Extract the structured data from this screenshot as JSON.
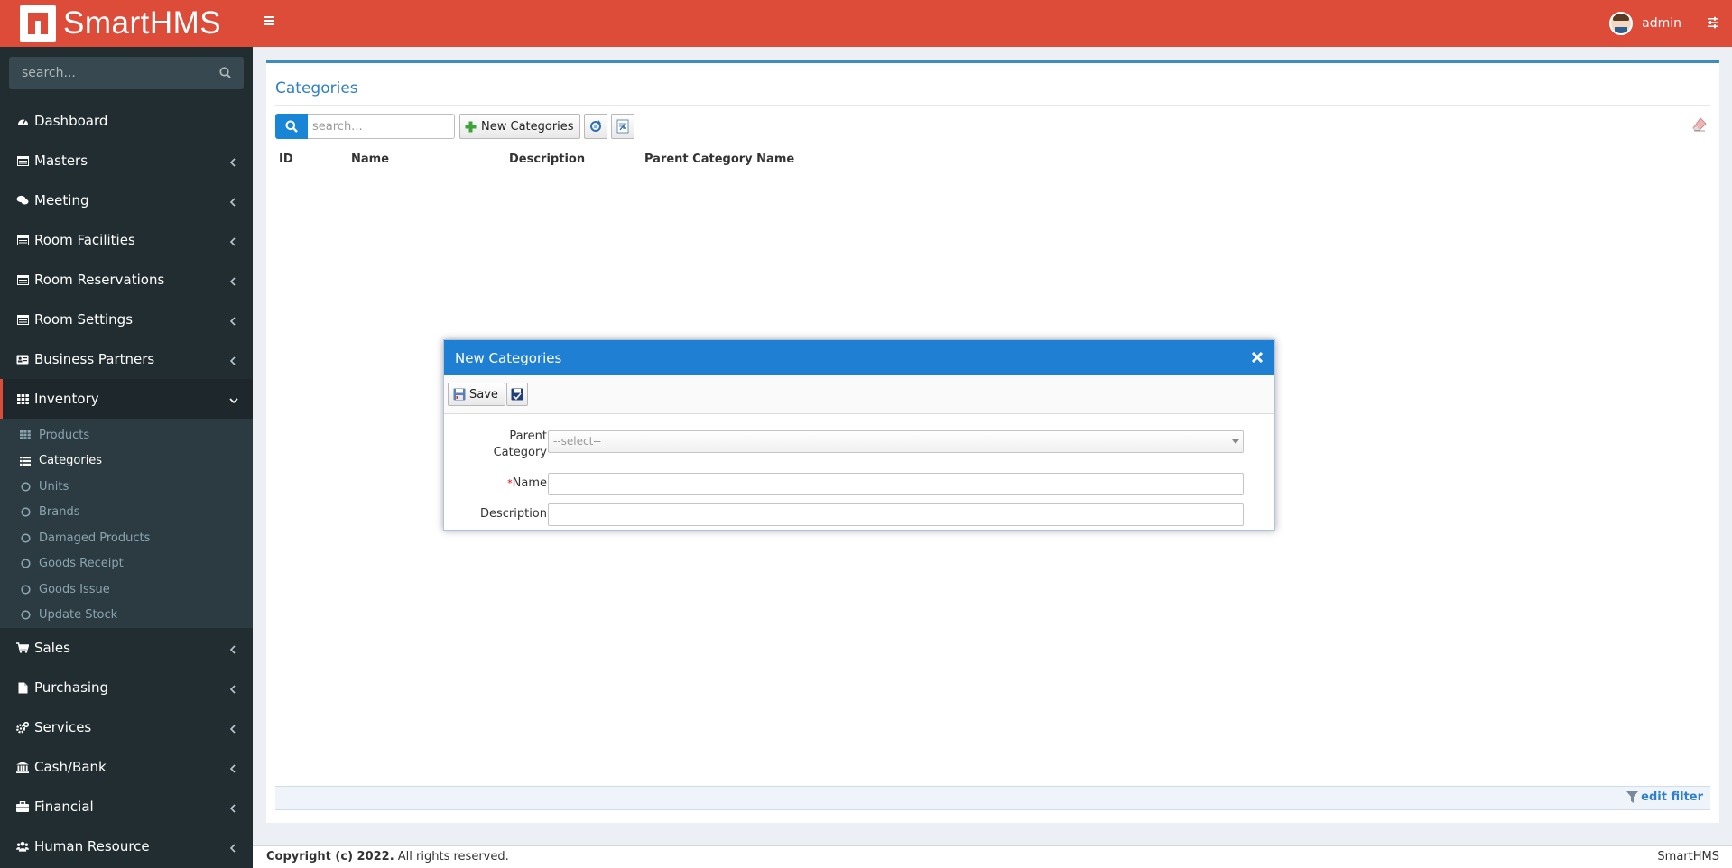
{
  "app": {
    "name": "SmartHMS"
  },
  "header": {
    "user_name": "admin"
  },
  "sidebar": {
    "search_placeholder": "search...",
    "items": [
      {
        "label": "Dashboard",
        "icon": "dashboard-icon"
      },
      {
        "label": "Masters",
        "icon": "table-icon"
      },
      {
        "label": "Meeting",
        "icon": "comments-icon"
      },
      {
        "label": "Room Facilities",
        "icon": "table-icon"
      },
      {
        "label": "Room Reservations",
        "icon": "table-icon"
      },
      {
        "label": "Room Settings",
        "icon": "table-icon"
      },
      {
        "label": "Business Partners",
        "icon": "id-card-icon"
      },
      {
        "label": "Inventory",
        "icon": "grid-icon"
      },
      {
        "label": "Sales",
        "icon": "cart-icon"
      },
      {
        "label": "Purchasing",
        "icon": "file-icon"
      },
      {
        "label": "Services",
        "icon": "cogs-icon"
      },
      {
        "label": "Cash/Bank",
        "icon": "bank-icon"
      },
      {
        "label": "Financial",
        "icon": "briefcase-icon"
      },
      {
        "label": "Human Resource",
        "icon": "users-icon"
      }
    ],
    "inventory_sub": [
      {
        "label": "Products"
      },
      {
        "label": "Categories"
      },
      {
        "label": "Units"
      },
      {
        "label": "Brands"
      },
      {
        "label": "Damaged Products"
      },
      {
        "label": "Goods Receipt"
      },
      {
        "label": "Goods Issue"
      },
      {
        "label": "Update Stock"
      }
    ]
  },
  "main": {
    "title": "Categories",
    "search_placeholder": "search...",
    "new_button": "New Categories",
    "columns": [
      "ID",
      "Name",
      "Description",
      "Parent Category Name"
    ],
    "edit_filter": "edit filter"
  },
  "dialog": {
    "title": "New Categories",
    "save_label": "Save",
    "parent_label_1": "Parent",
    "parent_label_2": "Category",
    "parent_placeholder": "--select--",
    "required_mark": "*",
    "name_label": "Name",
    "description_label": "Description"
  },
  "footer": {
    "copyright": "Copyright (c) 2022.",
    "rights": " All rights reserved.",
    "brand": "SmartHMS"
  },
  "colors": {
    "header": "#dd4b39",
    "sidebar": "#222d32",
    "accent_blue": "#1f7fd2"
  }
}
